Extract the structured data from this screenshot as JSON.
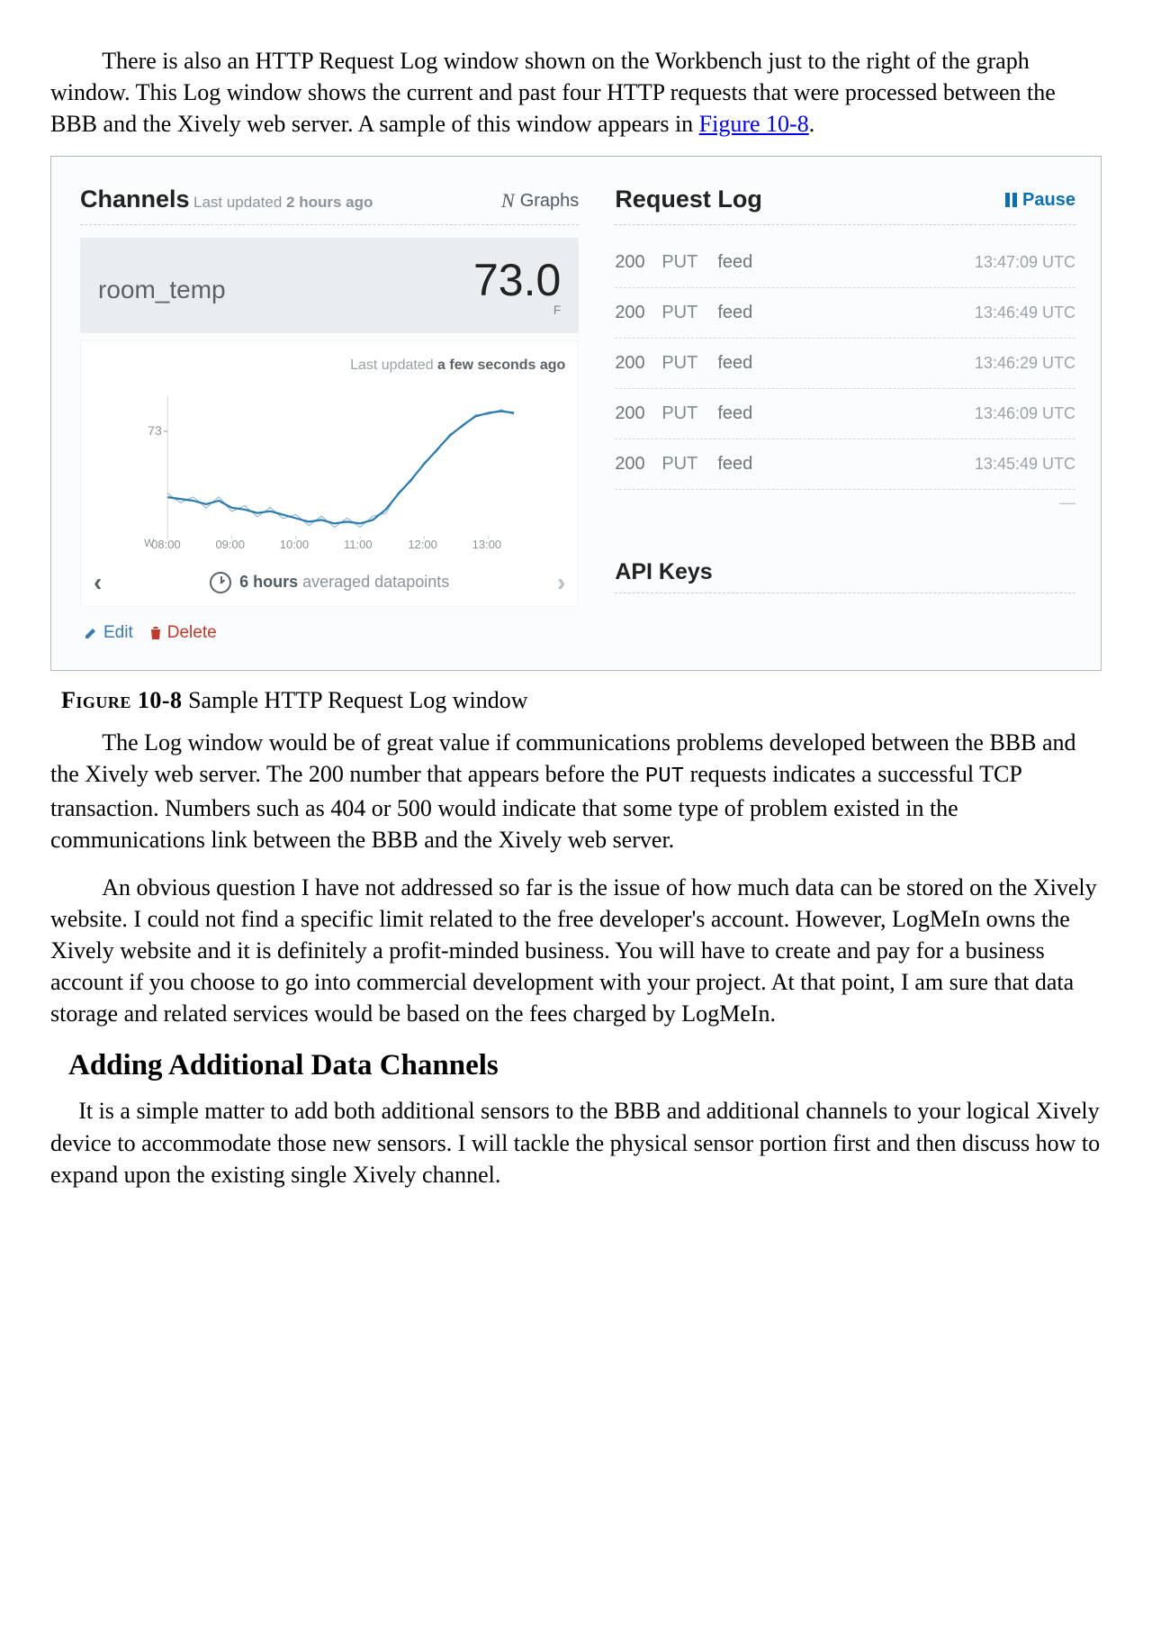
{
  "prose": {
    "p1": "There is also an HTTP Request Log window shown on the Workbench just to the right of the graph window. This Log window shows the current and past four HTTP requests that were processed between the BBB and the Xively web server. A sample of this window appears in ",
    "p1_link": "Figure 10-8",
    "p1_tail": ".",
    "caption_label": "Figure 10-8",
    "caption_text": " Sample HTTP Request Log window",
    "p2a": "The Log window would be of great value if communications problems developed between the BBB and the Xively web server. The 200 number that appears before the ",
    "p2_code": "PUT",
    "p2b": " requests indicates a successful TCP transaction. Numbers such as 404 or 500 would indicate that some type of problem existed in the communications link between the BBB and the Xively web server.",
    "p3": "An obvious question I have not addressed so far is the issue of how much data can be stored on the Xively website. I could not find a specific limit related to the free developer's account. However, LogMeIn owns the Xively website and it is definitely a profit-minded business. You will have to create and pay for a business account if you choose to go into commercial development with your project. At that point, I am sure that data storage and related services would be based on the fees charged by LogMeIn.",
    "h2": "Adding Additional Data Channels",
    "p4": "It is a simple matter to add both additional sensors to the BBB and additional channels to your logical Xively device to accommodate those new sensors. I will tackle the physical sensor portion first and then discuss how to expand upon the existing single Xively channel."
  },
  "figure": {
    "channels": {
      "title": "Channels",
      "subtitle_prefix": "Last updated ",
      "subtitle_bold": "2 hours ago",
      "graphs_label": "Graphs",
      "channel_name": "room_temp",
      "channel_value": "73.0",
      "channel_unit": "F",
      "chart_sub_prefix": "Last updated ",
      "chart_sub_bold": "a few seconds ago",
      "nav_range_bold": "6 hours",
      "nav_range_tail": " averaged datapoints",
      "edit": "Edit",
      "delete": "Delete"
    },
    "requestlog": {
      "title": "Request Log",
      "pause": "Pause",
      "rows": [
        {
          "code": "200",
          "method": "PUT",
          "target": "feed",
          "time": "13:47:09 UTC"
        },
        {
          "code": "200",
          "method": "PUT",
          "target": "feed",
          "time": "13:46:49 UTC"
        },
        {
          "code": "200",
          "method": "PUT",
          "target": "feed",
          "time": "13:46:29 UTC"
        },
        {
          "code": "200",
          "method": "PUT",
          "target": "feed",
          "time": "13:46:09 UTC"
        },
        {
          "code": "200",
          "method": "PUT",
          "target": "feed",
          "time": "13:45:49 UTC"
        }
      ],
      "dash": "—",
      "api_keys": "API Keys"
    }
  },
  "chart_data": {
    "type": "line",
    "title": "room_temp",
    "ylabel": "",
    "xlabel": "",
    "ylim": [
      66,
      74
    ],
    "y_tick": 73,
    "x_ticks": [
      "08:00",
      "09:00",
      "10:00",
      "11:00",
      "12:00",
      "13:00"
    ],
    "x": [
      8.0,
      8.2,
      8.4,
      8.6,
      8.8,
      9.0,
      9.2,
      9.4,
      9.6,
      9.8,
      10.0,
      10.2,
      10.4,
      10.6,
      10.8,
      11.0,
      11.2,
      11.4,
      11.6,
      11.8,
      12.0,
      12.2,
      12.4,
      12.6,
      12.8,
      13.0,
      13.2,
      13.4
    ],
    "values": [
      68.2,
      68.1,
      68.0,
      67.8,
      68.0,
      67.6,
      67.5,
      67.3,
      67.4,
      67.2,
      67.0,
      66.8,
      66.9,
      66.7,
      66.8,
      66.7,
      66.9,
      67.5,
      68.4,
      69.2,
      70.1,
      70.9,
      71.7,
      72.3,
      72.8,
      73.0,
      73.1,
      73.0
    ],
    "x_left_label": "W"
  }
}
